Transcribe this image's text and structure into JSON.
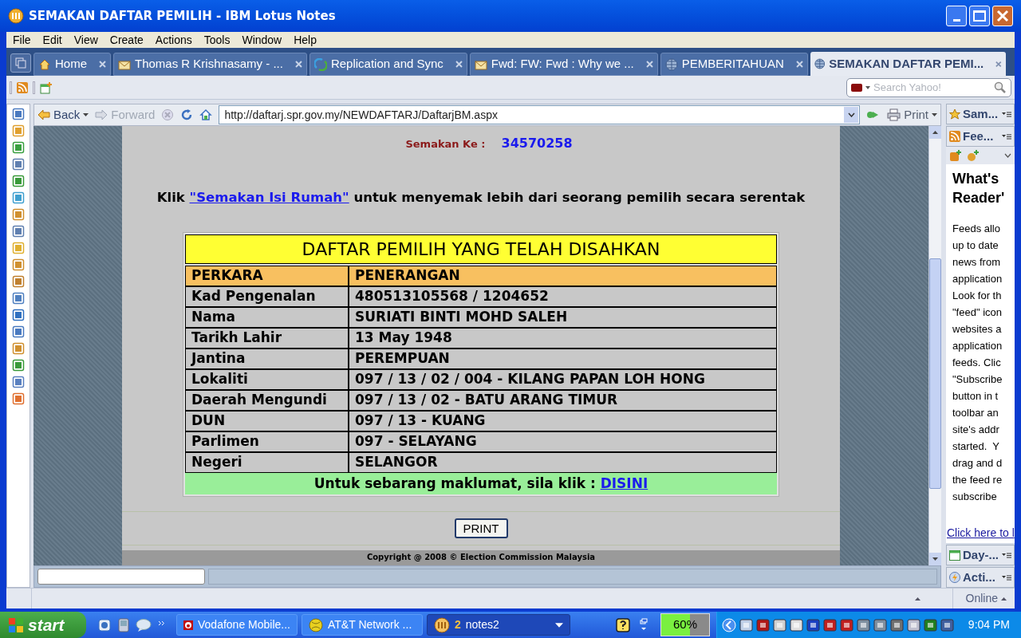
{
  "window": {
    "title": "SEMAKAN DAFTAR PEMILIH - IBM Lotus Notes"
  },
  "menu": [
    "File",
    "Edit",
    "View",
    "Create",
    "Actions",
    "Tools",
    "Window",
    "Help"
  ],
  "tabs": [
    {
      "label": "Home",
      "kind": "home",
      "selected": false
    },
    {
      "label": "Thomas R Krishnasamy - ...",
      "kind": "mail",
      "selected": false
    },
    {
      "label": "Replication and Sync",
      "kind": "sync",
      "selected": false
    },
    {
      "label": "Fwd: FW: Fwd : Why we ...",
      "kind": "mail",
      "selected": false
    },
    {
      "label": "PEMBERITAHUAN",
      "kind": "globe",
      "selected": false
    },
    {
      "label": "SEMAKAN DAFTAR PEMI...",
      "kind": "globe",
      "selected": true
    }
  ],
  "search": {
    "placeholder": "Search Yahoo!"
  },
  "browser": {
    "back": "Back",
    "forward": "Forward",
    "url": "http://daftarj.spr.gov.my/NEWDAFTARJ/DaftarjBM.aspx",
    "print": "Print"
  },
  "page": {
    "check_label": "Semakan Ke :",
    "check_number": "34570258",
    "intro": {
      "before": "Klik ",
      "link": "\"Semakan Isi Rumah\"",
      "after": " untuk menyemak lebih dari seorang pemilih secara serentak"
    },
    "table": {
      "title": "DAFTAR PEMILIH YANG TELAH DISAHKAN",
      "columns": [
        "PERKARA",
        "PENERANGAN"
      ],
      "rows": [
        [
          "Kad Pengenalan",
          "480513105568 / 1204652"
        ],
        [
          "Nama",
          "SURIATI BINTI MOHD SALEH"
        ],
        [
          "Tarikh Lahir",
          "13 May 1948"
        ],
        [
          "Jantina",
          "PEREMPUAN"
        ],
        [
          "Lokaliti",
          "097 / 13 / 02 / 004 - KILANG PAPAN LOH HONG"
        ],
        [
          "Daerah Mengundi",
          "097 / 13 / 02 - BATU ARANG TIMUR"
        ],
        [
          "DUN",
          "097 / 13 - KUANG"
        ],
        [
          "Parlimen",
          "097 - SELAYANG"
        ],
        [
          "Negeri",
          "SELANGOR"
        ]
      ],
      "footer": {
        "text": "Untuk sebarang maklumat, sila klik : ",
        "link": "DISINI"
      }
    },
    "print_button": "PRINT",
    "copyright": "Copyright @ 2008 © Election Commission Malaysia"
  },
  "sidebar": {
    "top_panels": [
      {
        "label": "Sam...",
        "kind": "star"
      },
      {
        "label": "Fee...",
        "kind": "feed"
      }
    ],
    "heading": [
      "What's",
      "Reader'"
    ],
    "body": [
      "Feeds allo",
      "up to date",
      "news from",
      "application",
      "Look for th",
      "\"feed\" icon",
      "websites a",
      "application",
      "feeds. Clic",
      "\"Subscribe",
      "button in t",
      "toolbar an",
      "site's addr",
      "started.  Y",
      "drag and d",
      "the feed re",
      "subscribe"
    ],
    "link": "Click here to l",
    "bottom_panels": [
      {
        "label": "Day-...",
        "kind": "calendar"
      },
      {
        "label": "Acti...",
        "kind": "bolt"
      }
    ]
  },
  "status": {
    "online": "Online"
  },
  "taskbar": {
    "start": "start",
    "items": [
      {
        "label": "Vodafone Mobile...",
        "kind": "vodafone",
        "selected": false
      },
      {
        "label": "AT&T Network ...",
        "kind": "globe",
        "selected": false
      },
      {
        "label": "notes2",
        "count": "2",
        "kind": "notes",
        "selected": true
      }
    ],
    "battery": {
      "reading": "60%",
      "level": 0.6
    },
    "clock": "9:04 PM"
  }
}
